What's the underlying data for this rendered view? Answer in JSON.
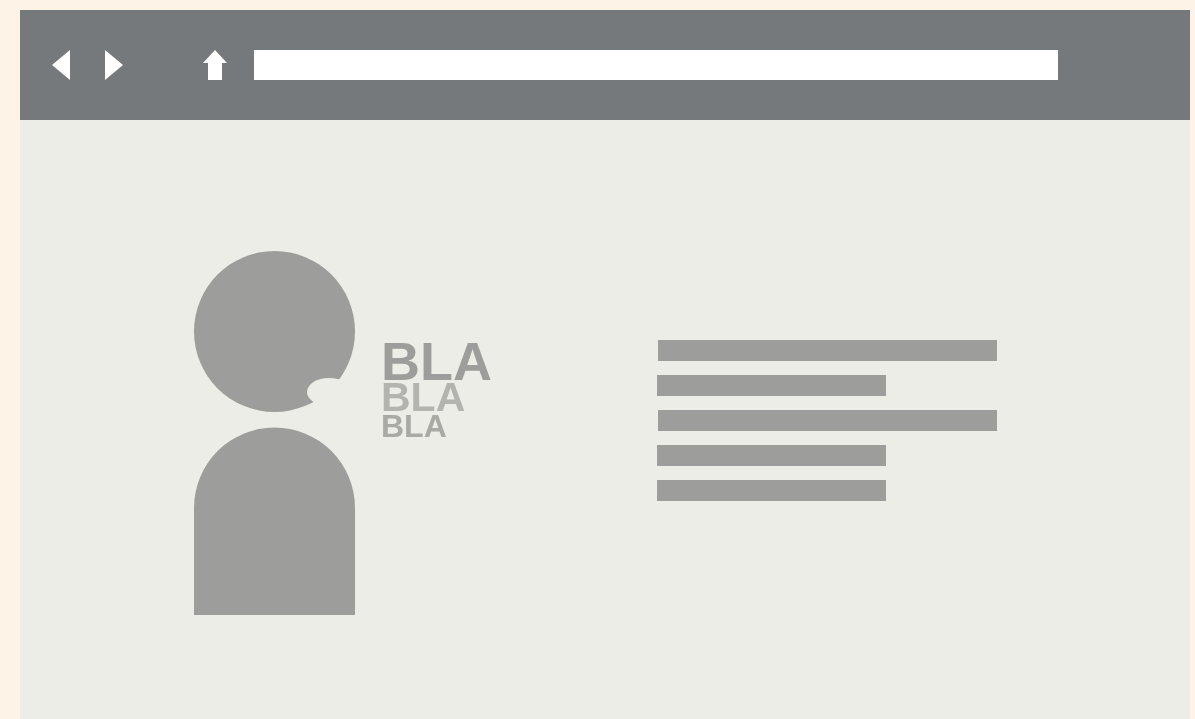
{
  "logo_texts": [
    {
      "text": "BLA",
      "kind": "primary"
    },
    {
      "text": "BLA",
      "kind": "secondary"
    },
    {
      "text": "BLA",
      "kind": "tertiary"
    }
  ]
}
